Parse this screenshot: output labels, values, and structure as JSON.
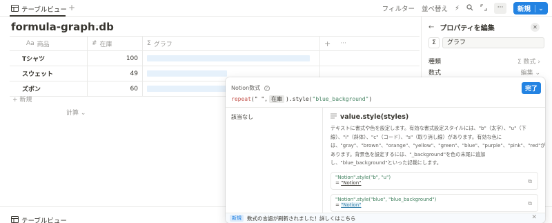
{
  "topbar": {
    "tab_label": "テーブルビュー",
    "add_tab": "+",
    "filter_label": "フィルター",
    "sort_label": "並べ替え",
    "more": "···",
    "new_label": "新規",
    "new_chevron": "⌄"
  },
  "database": {
    "title": "formula-graph.db",
    "title_more": "···"
  },
  "table": {
    "headers": {
      "name": "商品",
      "name_icon": "Aa",
      "stock": "在庫",
      "stock_icon": "#",
      "graph": "グラフ",
      "graph_icon": "Σ",
      "add_col": "+",
      "more": "···"
    },
    "rows": [
      {
        "name": "Tシャツ",
        "stock": "100",
        "bar_fraction": 1.0
      },
      {
        "name": "スウェット",
        "stock": "49",
        "bar_fraction": 0.49
      },
      {
        "name": "ズボン",
        "stock": "60",
        "bar_fraction": 0.6
      }
    ],
    "add_row": "+ 新規",
    "calculate": "計算 ⌄"
  },
  "bottom_view": {
    "label": "テーブルビュー"
  },
  "panel": {
    "back_icon": "←",
    "title": "プロパティを編集",
    "close_icon": "✕",
    "type_symbol": "Σ",
    "name_value": "グラフ",
    "type_label": "種類",
    "type_value": "Σ 数式 ›",
    "formula_label": "数式",
    "formula_value": "編集 ⌄"
  },
  "editor": {
    "label": "Notion数式",
    "help_icon": "?",
    "done_label": "完了",
    "code_func": "repeat",
    "code_open": "(\" \", ",
    "code_prop": "在庫",
    "code_mid": ").style(",
    "code_arg": "\"blue_background\"",
    "code_close": ")",
    "no_match": "該当なし",
    "function_title": "value.style(styles)",
    "description": "テキストに書式や色を設定します。有効な書式設定スタイルには、\"b\"（太字）、\"u\"（下線）、\"i\"（斜体）、\"c\"（コード）、\"s\"（取り消し線）があります。有効な色には、\"gray\"、\"brown\"、\"orange\"、\"yellow\"、\"green\"、\"blue\"、\"purple\"、\"pink\"、\"red\"があります。背景色を設定するには、\"_background\"を色の末尾に追加し、\"blue_background\"といった記載にします。",
    "examples": [
      {
        "code": "\"Notion\".style(\"b\", \"u\")",
        "result_prefix": "= ",
        "result": "\"Notion\""
      },
      {
        "code": "\"Notion\".style(\"blue\", \"blue_background\")",
        "result_prefix": "= ",
        "result": "\"Notion\""
      }
    ],
    "footer_badge": "新規",
    "footer_text": "数式の言語が刷新されました！詳しくはこちら",
    "footer_close": "✕"
  },
  "colors": {
    "accent": "#2383e2",
    "bar": "#e6f1fb"
  },
  "icons": [
    "table-icon",
    "bolt-icon",
    "search-icon",
    "expand-icon",
    "arrow-left-icon",
    "close-icon",
    "function-doc-icon",
    "copy-icon"
  ]
}
